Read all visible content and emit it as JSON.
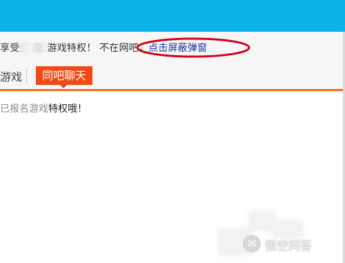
{
  "notice": {
    "text_a": "享受",
    "text_b": "游戏特权！ 不在网吧，",
    "link": "点击屏蔽弹窗"
  },
  "tabs": {
    "game": "游戏",
    "chat": "同吧聊天"
  },
  "content": {
    "text_faded": "已报名游戏",
    "text_main": "特权哦！"
  },
  "watermark": {
    "icon_glyph": "✉",
    "text": "悟空问答"
  },
  "colors": {
    "titlebar": "#0bb2ec",
    "accent": "#f04a14",
    "link": "#1a2ea8",
    "annotation": "#d0021b"
  }
}
